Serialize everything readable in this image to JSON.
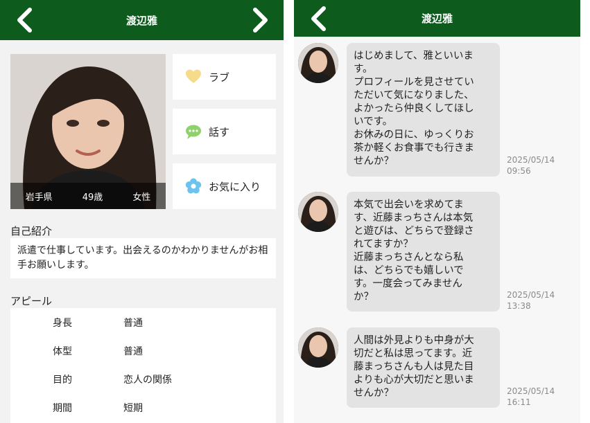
{
  "colors": {
    "header_bg": "#0d5c1e",
    "header_text": "#ffffff",
    "bubble_bg": "#e3e3e3",
    "love_icon": "#f6dc8a",
    "talk_icon": "#8fd16a",
    "fav_icon": "#6cc3ee"
  },
  "profile": {
    "header": {
      "title": "渡辺雅",
      "back_icon": "chevron-left-icon",
      "forward_icon": "chevron-right-icon"
    },
    "photo": {
      "prefecture": "岩手県",
      "age": "49歳",
      "gender": "女性"
    },
    "actions": [
      {
        "label": "ラブ",
        "icon": "heart-icon"
      },
      {
        "label": "話す",
        "icon": "chat-bubble-icon"
      },
      {
        "label": "お気に入り",
        "icon": "flower-icon"
      }
    ],
    "intro": {
      "title": "自己紹介",
      "text": "派遣で仕事しています。出会えるのかわかりませんがお相手お願いします。"
    },
    "appeal": {
      "title": "アピール",
      "rows": [
        {
          "key": "身長",
          "value": "普通"
        },
        {
          "key": "体型",
          "value": "普通"
        },
        {
          "key": "目的",
          "value": "恋人の関係"
        },
        {
          "key": "期間",
          "value": "短期"
        }
      ]
    }
  },
  "chat": {
    "header": {
      "title": "渡辺雅",
      "back_icon": "chevron-left-icon"
    },
    "messages": [
      {
        "text": "はじめまして、雅といいま\nす。\nプロフィールを見させてい\nただいて気になりました、\nよかったら仲良くしてほし\nいです。\nお休みの日に、ゆっくりお\n茶か軽くお食事でも行きま\nせんか？",
        "time": "2025/05/14\n09:56"
      },
      {
        "text": "本気で出会いを求めてま\nす、近藤まっちさんは本気\nと遊びは、どちらで登録さ\nれてますか？\n近藤まっちさんとなら私\nは、どちらでも嬉しいで\nす。一度会ってみません\nか？",
        "time": "2025/05/14\n13:38"
      },
      {
        "text": "人間は外見よりも中身が大\n切だと私は思ってます。近\n藤まっちさんも人は見た目\nよりも心が大切だと思いま\nせんか？",
        "time": "2025/05/14\n16:11"
      }
    ]
  }
}
